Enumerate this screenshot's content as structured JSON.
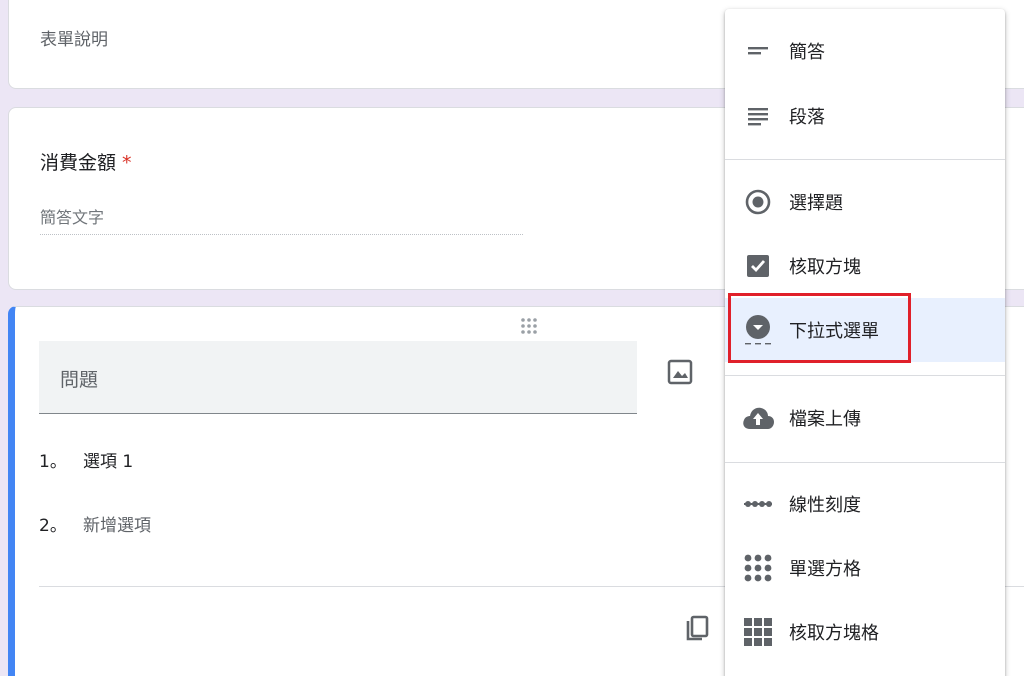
{
  "form": {
    "description_placeholder": "表單說明",
    "question1": {
      "title": "消費金額",
      "required_mark": "*",
      "answer_placeholder": "簡答文字"
    },
    "question2": {
      "title_placeholder": "問題",
      "options": [
        {
          "number": "1。",
          "label": "選項 1"
        },
        {
          "number": "2。",
          "label": "新增選項"
        }
      ]
    }
  },
  "type_menu": {
    "items": [
      {
        "label": "簡答",
        "icon": "short-answer-icon"
      },
      {
        "label": "段落",
        "icon": "paragraph-icon"
      },
      {
        "label": "選擇題",
        "icon": "radio-button-icon"
      },
      {
        "label": "核取方塊",
        "icon": "checkbox-icon"
      },
      {
        "label": "下拉式選單",
        "icon": "dropdown-icon",
        "selected": true
      },
      {
        "label": "檔案上傳",
        "icon": "cloud-upload-icon"
      },
      {
        "label": "線性刻度",
        "icon": "linear-scale-icon"
      },
      {
        "label": "單選方格",
        "icon": "radio-grid-icon"
      },
      {
        "label": "核取方塊格",
        "icon": "checkbox-grid-icon"
      }
    ]
  },
  "colors": {
    "accent": "#4285f4",
    "required": "#d93025",
    "highlight": "#e0202a",
    "selected_bg": "#e8f0fe",
    "page_bg": "#ece6f5"
  }
}
